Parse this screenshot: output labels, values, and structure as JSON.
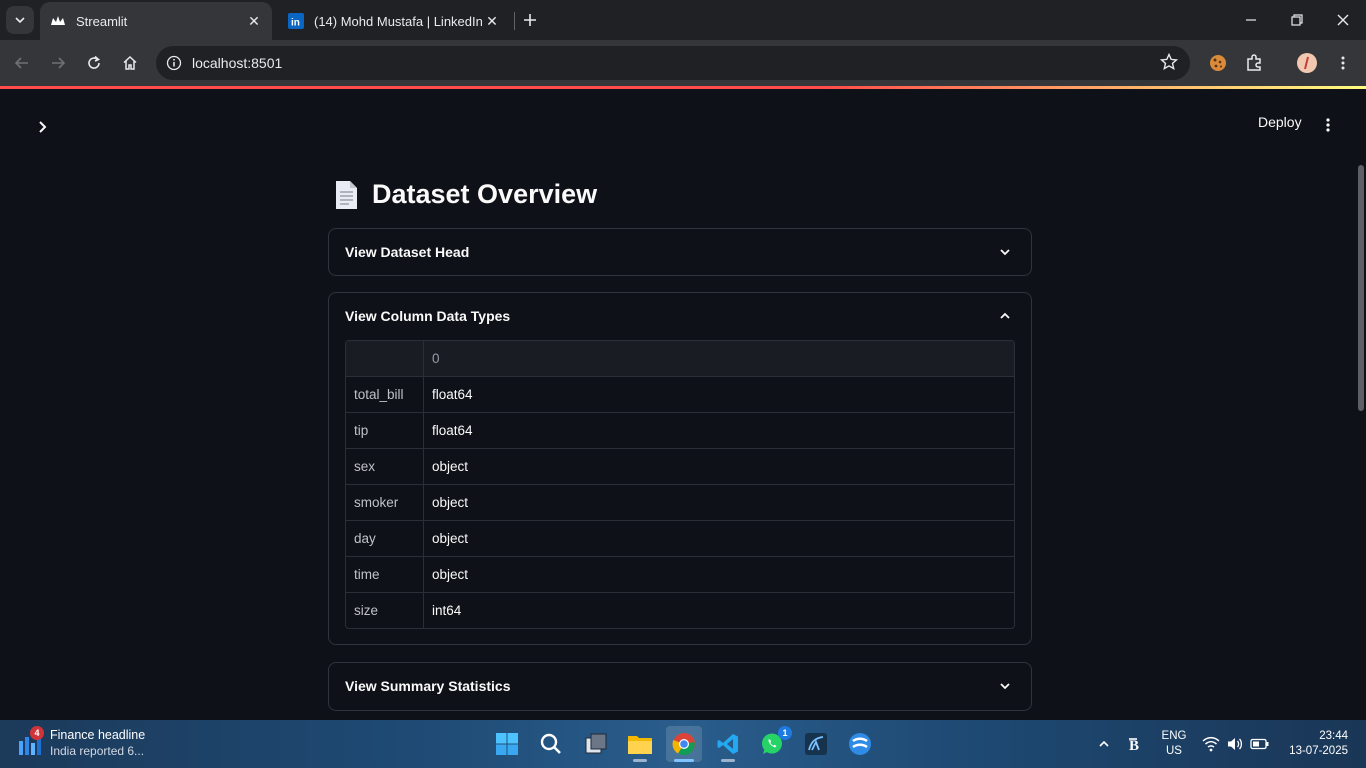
{
  "browser": {
    "tabs": [
      {
        "title": "Streamlit",
        "active": true,
        "icon": "streamlit-crown-icon"
      },
      {
        "title": "(14) Mohd Mustafa | LinkedIn",
        "active": false,
        "icon": "linkedin-icon"
      }
    ],
    "url": "localhost:8501"
  },
  "app": {
    "deploy_label": "Deploy",
    "page_title": "Dataset Overview",
    "title_icon": "page-facing-up-icon",
    "expanders": [
      {
        "label": "View Dataset Head",
        "expanded": false
      },
      {
        "label": "View Column Data Types",
        "expanded": true
      },
      {
        "label": "View Summary Statistics",
        "expanded": false
      }
    ],
    "dtypes_table": {
      "column_header": "0",
      "rows": [
        {
          "index": "total_bill",
          "value": "float64"
        },
        {
          "index": "tip",
          "value": "float64"
        },
        {
          "index": "sex",
          "value": "object"
        },
        {
          "index": "smoker",
          "value": "object"
        },
        {
          "index": "day",
          "value": "object"
        },
        {
          "index": "time",
          "value": "object"
        },
        {
          "index": "size",
          "value": "int64"
        }
      ]
    }
  },
  "taskbar": {
    "news": {
      "badge": "4",
      "title": "Finance headline",
      "subtitle": "India reported 6..."
    },
    "apps": [
      "windows-start-icon",
      "search-icon",
      "task-view-icon",
      "file-explorer-icon",
      "chrome-icon",
      "vscode-icon",
      "whatsapp-icon",
      "mysql-workbench-icon",
      "app-icon"
    ],
    "whatsapp_badge": "1",
    "language": {
      "line1": "ENG",
      "line2": "US"
    },
    "clock": {
      "time": "23:44",
      "date": "13-07-2025"
    }
  },
  "colors": {
    "accent": "#ff4b4b",
    "background": "#0e1117",
    "border": "#31333f"
  }
}
